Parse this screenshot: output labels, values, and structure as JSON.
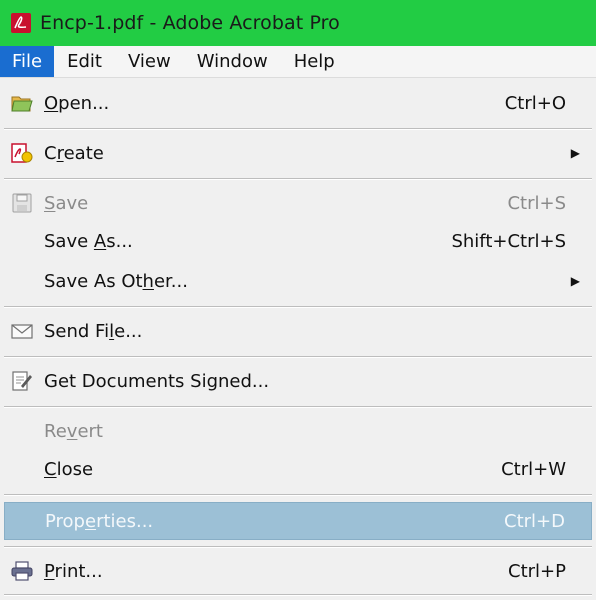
{
  "window": {
    "title": "Encp-1.pdf - Adobe Acrobat Pro",
    "title_bar_color": "#22cc44"
  },
  "menubar": {
    "items": [
      {
        "label": "File",
        "active": true
      },
      {
        "label": "Edit"
      },
      {
        "label": "View"
      },
      {
        "label": "Window"
      },
      {
        "label": "Help"
      }
    ],
    "active_color": "#1a6dd0"
  },
  "file_menu": {
    "items": [
      {
        "pre": "",
        "u": "O",
        "post": "pen...",
        "shortcut": "Ctrl+O",
        "icon": "open-folder-icon"
      },
      {
        "pre": "C",
        "u": "r",
        "post": "eate",
        "submenu": true,
        "icon": "create-pdf-icon"
      },
      {
        "pre": "",
        "u": "S",
        "post": "ave",
        "shortcut": "Ctrl+S",
        "disabled": true,
        "icon": "save-disk-icon"
      },
      {
        "pre": "Save ",
        "u": "A",
        "post": "s...",
        "shortcut": "Shift+Ctrl+S"
      },
      {
        "pre": "Save As Ot",
        "u": "h",
        "post": "er...",
        "submenu": true
      },
      {
        "pre": "Send Fi",
        "u": "l",
        "post": "e...",
        "icon": "envelope-icon"
      },
      {
        "pre": "Get Documents Signed...",
        "u": "",
        "post": "",
        "icon": "sign-document-icon"
      },
      {
        "pre": "Re",
        "u": "v",
        "post": "ert",
        "disabled": true
      },
      {
        "pre": "",
        "u": "C",
        "post": "lose",
        "shortcut": "Ctrl+W"
      },
      {
        "pre": "Prop",
        "u": "e",
        "post": "rties...",
        "shortcut": "Ctrl+D",
        "highlighted": true
      },
      {
        "pre": "",
        "u": "P",
        "post": "rint...",
        "shortcut": "Ctrl+P",
        "icon": "printer-icon"
      }
    ],
    "highlight_color": "#9cc0d6"
  }
}
